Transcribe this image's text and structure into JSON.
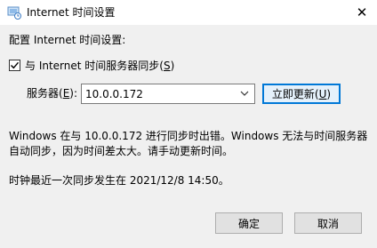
{
  "window": {
    "title": "Internet 时间设置",
    "close_glyph": "✕"
  },
  "section_header": "配置 Internet 时间设置:",
  "sync_checkbox": {
    "label_prefix": "与 Internet 时间服务器同步(",
    "accel": "S",
    "label_suffix": ")",
    "checked": true
  },
  "server": {
    "label_prefix": "服务器(",
    "accel": "E",
    "label_suffix": "):",
    "value": "10.0.0.172"
  },
  "update_button": {
    "label_prefix": "立即更新(",
    "accel": "U",
    "label_suffix": ")"
  },
  "status": {
    "line1": "Windows 在与 10.0.0.172 进行同步时出错。Windows 无法与时间服务器",
    "line2": "自动同步，因为时间差太大。请手动更新时间。"
  },
  "last_sync": "时钟最近一次同步发生在 2021/12/8 14:50。",
  "ok_label": "确定",
  "cancel_label": "取消",
  "colors": {
    "accent": "#0078d7",
    "window_bg": "#f0f0f0",
    "titlebar_bg": "#ffffff"
  }
}
